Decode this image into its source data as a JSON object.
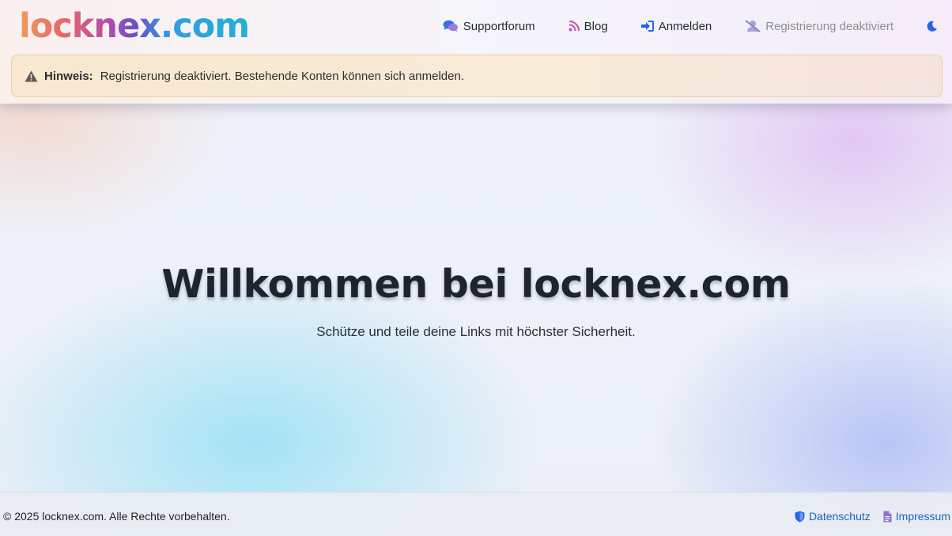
{
  "header": {
    "logo": "locknex.com",
    "nav": [
      {
        "label": "Supportforum",
        "icon": "comments-icon"
      },
      {
        "label": "Blog",
        "icon": "rss-icon"
      },
      {
        "label": "Anmelden",
        "icon": "sign-in-icon"
      },
      {
        "label": "Registrierung deaktiviert",
        "icon": "user-slash-icon"
      }
    ],
    "theme_toggle_icon": "moon-icon"
  },
  "alert": {
    "title": "Hinweis:",
    "message": "Registrierung deaktiviert. Bestehende Konten können sich anmelden.",
    "icon": "warning-icon"
  },
  "hero": {
    "title": "Willkommen bei locknex.com",
    "subtitle": "Schütze und teile deine Links mit höchster Sicherheit."
  },
  "footer": {
    "copyright": "© 2025 locknex.com. Alle Rechte vorbehalten.",
    "links": [
      {
        "label": "Datenschutz",
        "icon": "shield-icon"
      },
      {
        "label": "Impressum",
        "icon": "document-icon"
      }
    ]
  },
  "colors": {
    "link": "#1f5fbf",
    "alert_border": "#f0cf97",
    "alert_bg": "#f8e8cf",
    "icon_blue": "#2563eb"
  }
}
